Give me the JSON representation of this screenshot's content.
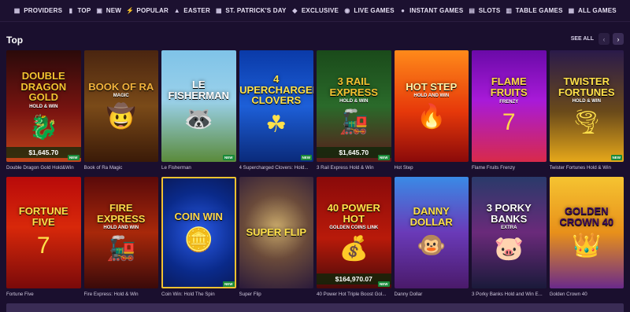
{
  "nav": [
    {
      "label": "PROVIDERS",
      "icon": "grid-icon",
      "glyph": "▦"
    },
    {
      "label": "TOP",
      "icon": "chart-icon",
      "glyph": "▮"
    },
    {
      "label": "NEW",
      "icon": "new-icon",
      "glyph": "▣"
    },
    {
      "label": "POPULAR",
      "icon": "bolt-icon",
      "glyph": "⚡"
    },
    {
      "label": "EASTER",
      "icon": "egg-icon",
      "glyph": "▲"
    },
    {
      "label": "ST. PATRICK'S DAY",
      "icon": "clover-icon",
      "glyph": "▦"
    },
    {
      "label": "EXCLUSIVE",
      "icon": "diamond-icon",
      "glyph": "◆"
    },
    {
      "label": "LIVE GAMES",
      "icon": "live-icon",
      "glyph": "◉"
    },
    {
      "label": "INSTANT GAMES",
      "icon": "person-icon",
      "glyph": "●"
    },
    {
      "label": "SLOTS",
      "icon": "slots-icon",
      "glyph": "▤"
    },
    {
      "label": "TABLE GAMES",
      "icon": "table-icon",
      "glyph": "▥"
    },
    {
      "label": "ALL GAMES",
      "icon": "all-games-icon",
      "glyph": "▦"
    }
  ],
  "section": {
    "title": "Top",
    "see_all": "SEE ALL",
    "prev_glyph": "‹",
    "next_glyph": "›"
  },
  "new_badge": "NEW",
  "games": [
    {
      "name": "Double Dragon Gold Hold&Win",
      "logo": "Double Dragon Gold",
      "sub": "HOLD & WIN",
      "jackpot": "$1,645.70",
      "new": true,
      "bg": "linear-gradient(180deg,#2a0a0a 0%,#7a1410 55%,#c0441a 100%)",
      "logo_color": "#f5c331",
      "deco": "🐉"
    },
    {
      "name": "Book of Ra Magic",
      "logo": "Book of Ra",
      "sub": "MAGIC",
      "jackpot": "",
      "new": false,
      "bg": "linear-gradient(180deg,#4a2510 0%,#7a4a18 50%,#3a1a08 100%)",
      "logo_color": "#f3b33c",
      "deco": "🤠"
    },
    {
      "name": "Le Fisherman",
      "logo": "Le Fisherman",
      "sub": "",
      "jackpot": "",
      "new": true,
      "bg": "linear-gradient(180deg,#7fc3e8 0%,#9ad1ea 45%,#5a8a3a 100%)",
      "logo_color": "#ffffff",
      "deco": "🦝"
    },
    {
      "name": "4 Supercharged Clovers: Hold...",
      "logo": "4 Supercharged Clovers",
      "sub": "",
      "jackpot": "",
      "new": true,
      "bg": "linear-gradient(180deg,#0a3aa8 0%,#1d5fd8 50%,#0a2a7a 100%)",
      "logo_color": "#ffe14a",
      "deco": "☘"
    },
    {
      "name": "3 Rail Express Hold & Win",
      "logo": "3 Rail Express",
      "sub": "HOLD & WIN",
      "jackpot": "$1,645.70",
      "new": true,
      "bg": "linear-gradient(180deg,#1a4a1a 0%,#2a6a2a 50%,#5a1a1a 100%)",
      "logo_color": "#f5c331",
      "deco": "🚂"
    },
    {
      "name": "Hot Step",
      "logo": "Hot Step",
      "sub": "HOLD AND WIN",
      "jackpot": "",
      "new": false,
      "bg": "linear-gradient(180deg,#ff8a1a 0%,#e6380a 55%,#8a0a0a 100%)",
      "logo_color": "#fff2a8",
      "deco": "🔥"
    },
    {
      "name": "Flame Fruits Frenzy",
      "logo": "Flame Fruits",
      "sub": "FRENZY",
      "jackpot": "",
      "new": false,
      "bg": "linear-gradient(180deg,#6a0aa8 0%,#a81ad8 45%,#d82a4a 100%)",
      "logo_color": "#ffd84a",
      "deco": "7"
    },
    {
      "name": "Twister Fortunes Hold & Win",
      "logo": "Twister Fortunes",
      "sub": "HOLD & WIN",
      "jackpot": "",
      "new": true,
      "bg": "linear-gradient(180deg,#2a1a4a 0%,#6a4a1a 55%,#e6a81a 100%)",
      "logo_color": "#ffe14a",
      "deco": "🌪"
    },
    {
      "name": "Fortune Five",
      "logo": "Fortune Five",
      "sub": "",
      "jackpot": "",
      "new": false,
      "bg": "linear-gradient(180deg,#b80a0a 0%,#d8280a 45%,#7a0a0a 100%)",
      "logo_color": "#ffe14a",
      "deco": "7"
    },
    {
      "name": "Fire Express: Hold & Win",
      "logo": "Fire Express",
      "sub": "HOLD AND WIN",
      "jackpot": "",
      "new": false,
      "bg": "linear-gradient(180deg,#5a0a0a 0%,#a8280a 50%,#3a0a0a 100%)",
      "logo_color": "#ffd84a",
      "deco": "🚂"
    },
    {
      "name": "Coin Win: Hold The Spin",
      "logo": "Coin Win",
      "sub": "",
      "jackpot": "",
      "new": true,
      "bg": "radial-gradient(circle at 50% 50%,#2a5ae6 0%,#0a2a8a 60%,#0a1a5a 100%)",
      "logo_color": "#ffd84a",
      "deco": "🪙"
    },
    {
      "name": "Super Flip",
      "logo": "Super Flip",
      "sub": "",
      "jackpot": "",
      "new": false,
      "bg": "radial-gradient(circle at 50% 45%,#c8a86a 0%,#6a4a3a 45%,#2a1a3a 100%)",
      "logo_color": "#ffe14a",
      "deco": ""
    },
    {
      "name": "40 Power Hot Triple Boost Gol...",
      "logo": "40 Power Hot",
      "sub": "GOLDEN COINS LINK",
      "jackpot": "$164,970.07",
      "new": true,
      "bg": "linear-gradient(180deg,#8a0a0a 0%,#b81a0a 55%,#4a0a0a 100%)",
      "logo_color": "#ffe14a",
      "deco": "💰"
    },
    {
      "name": "Danny Dollar",
      "logo": "Danny Dollar",
      "sub": "",
      "jackpot": "",
      "new": false,
      "bg": "linear-gradient(180deg,#3a8ae6 0%,#6a3ab8 50%,#4a1a6a 100%)",
      "logo_color": "#ffe14a",
      "deco": "🐵"
    },
    {
      "name": "3 Porky Banks Hold and Win E...",
      "logo": "3 Porky Banks",
      "sub": "EXTRA",
      "jackpot": "",
      "new": false,
      "bg": "linear-gradient(180deg,#2a3a6a 0%,#6a2a7a 50%,#1a1a3a 100%)",
      "logo_color": "#ffffff",
      "deco": "🐷"
    },
    {
      "name": "Golden Crown 40",
      "logo": "Golden Crown 40",
      "sub": "",
      "jackpot": "",
      "new": false,
      "bg": "linear-gradient(180deg,#f5c331 0%,#e8901a 50%,#6a2a8a 100%)",
      "logo_color": "#3a0a5a",
      "deco": "👑"
    }
  ]
}
